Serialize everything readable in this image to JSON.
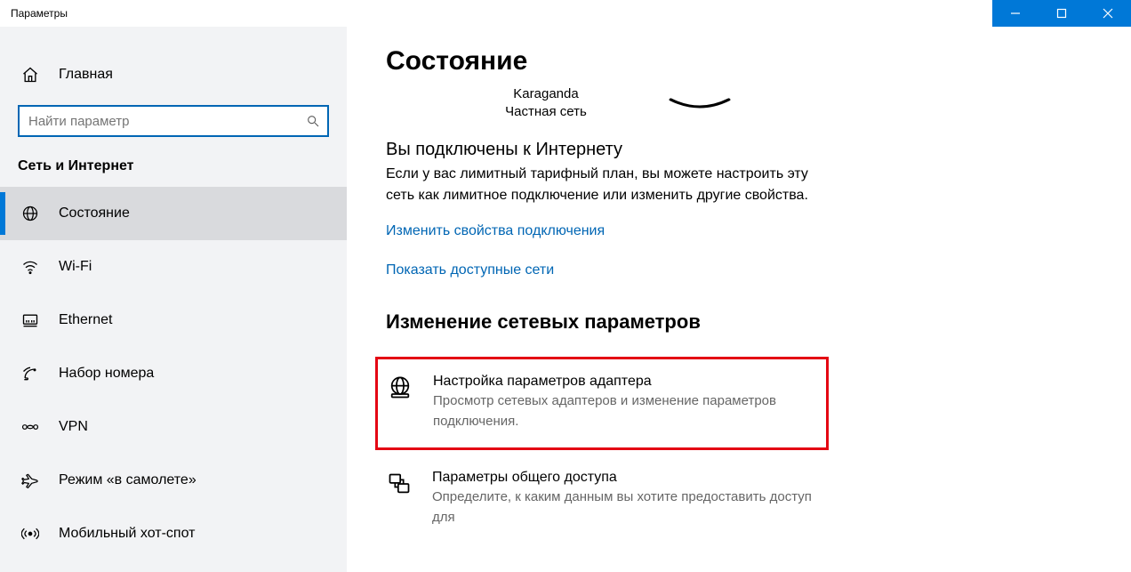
{
  "window": {
    "title": "Параметры"
  },
  "sidebar": {
    "home_label": "Главная",
    "search_placeholder": "Найти параметр",
    "category": "Сеть и Интернет",
    "items": [
      {
        "label": "Состояние"
      },
      {
        "label": "Wi-Fi"
      },
      {
        "label": "Ethernet"
      },
      {
        "label": "Набор номера"
      },
      {
        "label": "VPN"
      },
      {
        "label": "Режим «в самолете»"
      },
      {
        "label": "Мобильный хот-спот"
      }
    ]
  },
  "content": {
    "page_title": "Состояние",
    "network_name": "Karaganda",
    "network_type": "Частная сеть",
    "status_heading": "Вы подключены к Интернету",
    "status_desc": "Если у вас лимитный тарифный план, вы можете настроить эту сеть как лимитное подключение или изменить другие свойства.",
    "link_change_props": "Изменить свойства подключения",
    "link_show_networks": "Показать доступные сети",
    "section_heading": "Изменение сетевых параметров",
    "option_adapter": {
      "title": "Настройка параметров адаптера",
      "desc": "Просмотр сетевых адаптеров и изменение параметров подключения."
    },
    "option_sharing": {
      "title": "Параметры общего доступа",
      "desc": "Определите, к каким данным вы хотите предоставить доступ для"
    }
  }
}
